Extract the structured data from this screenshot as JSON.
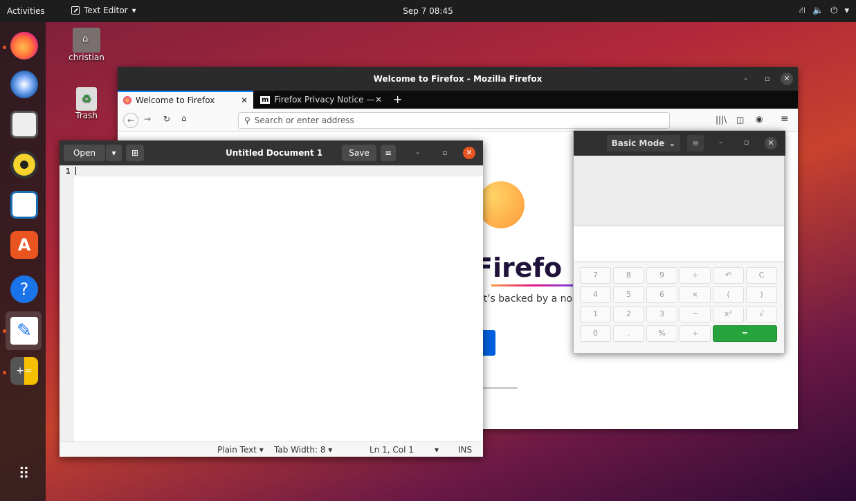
{
  "topbar": {
    "activities": "Activities",
    "app_menu": "Text Editor",
    "clock": "Sep 7  08:45",
    "tray_network": "⛙",
    "tray_volume": "🔈",
    "tray_power": "⏻"
  },
  "desktop": {
    "home_label": "christian",
    "trash_label": "Trash"
  },
  "firefox": {
    "window_title": "Welcome to Firefox - Mozilla Firefox",
    "tabs": [
      {
        "label": "Welcome to Firefox",
        "icon": "firefox-icon"
      },
      {
        "label": "Firefox Privacy Notice —",
        "icon": "mozilla-m-icon",
        "icon_text": "m"
      }
    ],
    "new_tab": "+",
    "url_placeholder": "Search or enter address",
    "page_heading_fragment": "Firefo",
    "page_text_fragment": "at’s backed by a no"
  },
  "editor": {
    "open_label": "Open",
    "doc_title": "Untitled Document 1",
    "save_label": "Save",
    "line_number": "1",
    "status": {
      "language": "Plain Text",
      "tab_width": "Tab Width: 8",
      "position": "Ln 1, Col 1",
      "mode": "INS"
    }
  },
  "calculator": {
    "mode_label": "Basic Mode",
    "buttons": {
      "b7": "7",
      "b8": "8",
      "b9": "9",
      "div": "÷",
      "undo": "↶",
      "clear": "C",
      "b4": "4",
      "b5": "5",
      "b6": "6",
      "mul": "×",
      "lparen": "(",
      "rparen": ")",
      "b1": "1",
      "b2": "2",
      "b3": "3",
      "minus": "−",
      "square": "x²",
      "sqrt": "√",
      "b0": "0",
      "dot": ".",
      "percent": "%",
      "plus": "+",
      "equals": "="
    }
  },
  "colors": {
    "ubuntu_orange": "#e95420",
    "equals_green": "#26a33c",
    "firefox_blue": "#0060df"
  }
}
